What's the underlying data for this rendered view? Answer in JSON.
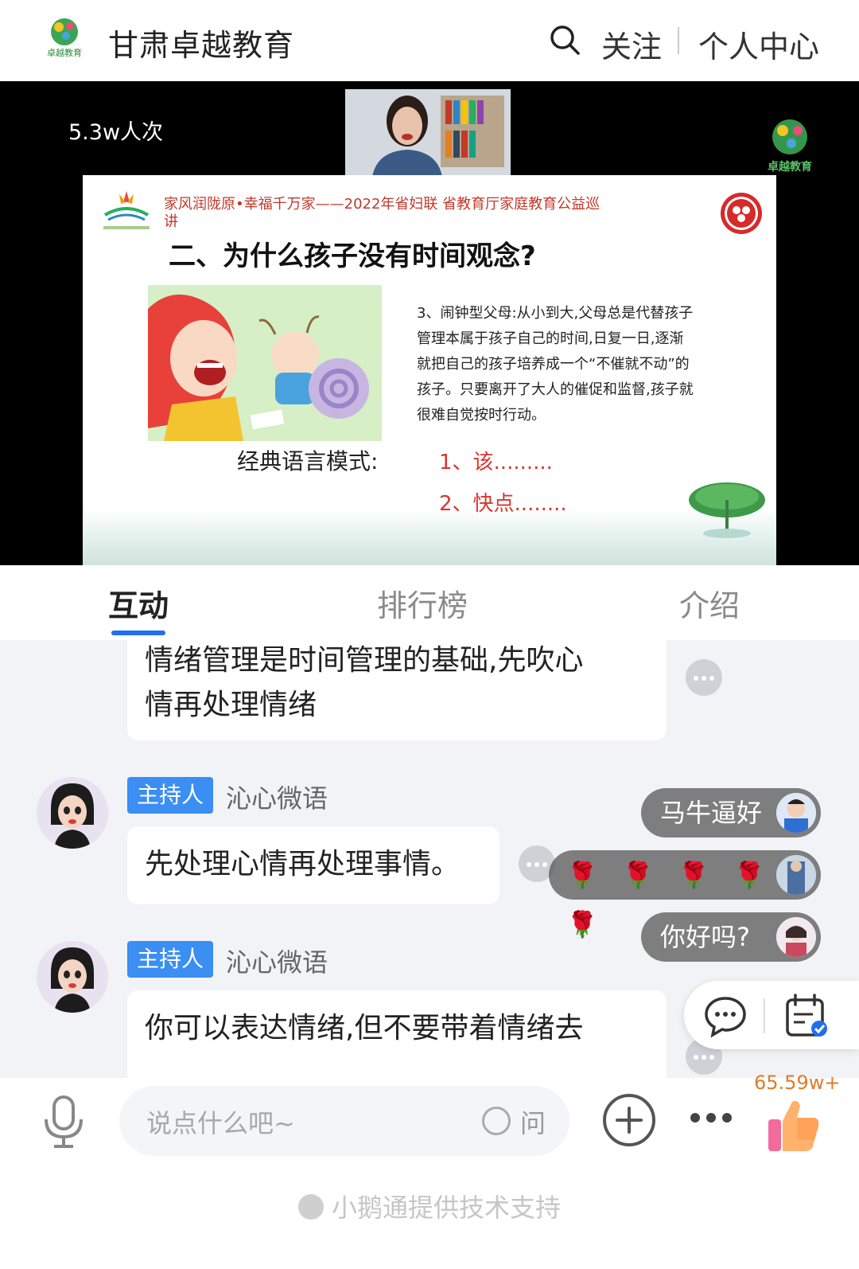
{
  "header": {
    "brand": "甘肃卓越教育",
    "logo_text": "卓越教育",
    "follow": "关注",
    "personal_center": "个人中心"
  },
  "video": {
    "view_count": "5.3w人次",
    "watermark_text": "卓越教育",
    "slide": {
      "header_line": "家风润陇原•幸福千万家——2022年省妇联 省教育厅家庭教育公益巡讲",
      "title": "二、为什么孩子没有时间观念?",
      "body": "3、闹钟型父母:从小到大,父母总是代替孩子管理本属于孩子自己的时间,日复一日,逐渐就把自己的孩子培养成一个“不催就不动”的孩子。只要离开了大人的催促和监督,孩子就很难自觉按时行动。",
      "lead": "经典语言模式:",
      "points": [
        "1、该.........",
        "2、快点........"
      ]
    }
  },
  "tabs": [
    {
      "label": "互动",
      "active": true
    },
    {
      "label": "排行榜",
      "active": false
    },
    {
      "label": "介绍",
      "active": false
    }
  ],
  "chat": {
    "messages": [
      {
        "role": "",
        "name": "",
        "text_lines": [
          "情绪管理是时间管理的基础,先吹心",
          "情再处理情绪"
        ]
      },
      {
        "role": "主持人",
        "name": "沁心微语",
        "text_lines": [
          "先处理心情再处理事情。"
        ]
      },
      {
        "role": "主持人",
        "name": "沁心微语",
        "text_lines": [
          "你可以表达情绪,但不要带着情绪去"
        ]
      }
    ],
    "danmaku": [
      {
        "text": "马牛逼好"
      },
      {
        "text": "🌹 🌹 🌹 🌹 🌹"
      },
      {
        "text": "你好吗?"
      }
    ]
  },
  "composer": {
    "placeholder": "说点什么吧~",
    "ask_label": "问",
    "like_count": "65.59w+"
  },
  "footer": {
    "powered_by": "小鹅通提供技术支持"
  },
  "colors": {
    "accent": "#1f6ff0",
    "role_badge": "#3b8ef2",
    "slide_red": "#d9352f",
    "like_orange": "#e07b2a"
  }
}
